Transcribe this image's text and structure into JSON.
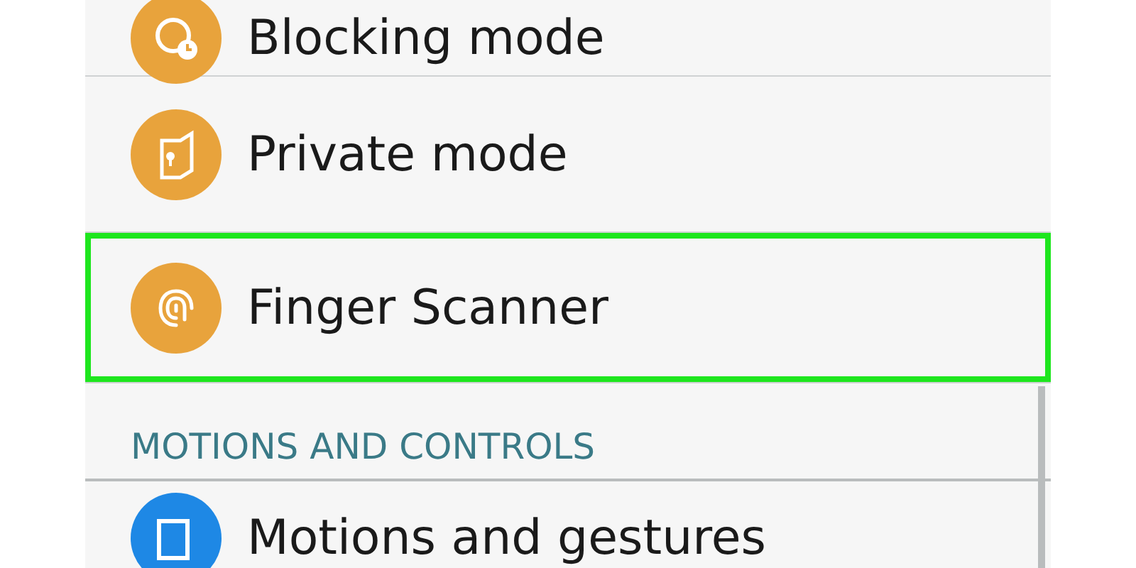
{
  "settings_list": [
    {
      "kind": "row",
      "label": "Blocking mode",
      "color": "#e8a33c",
      "highlighted": false
    },
    {
      "kind": "row",
      "label": "Private mode",
      "color": "#e8a33c",
      "highlighted": false
    },
    {
      "kind": "row",
      "label": "Finger Scanner",
      "color": "#e8a33c",
      "highlighted": true
    },
    {
      "kind": "header",
      "label": "MOTIONS AND CONTROLS"
    },
    {
      "kind": "row",
      "label": "Motions and gestures",
      "color": "#1e88e5",
      "highlighted": false
    }
  ]
}
